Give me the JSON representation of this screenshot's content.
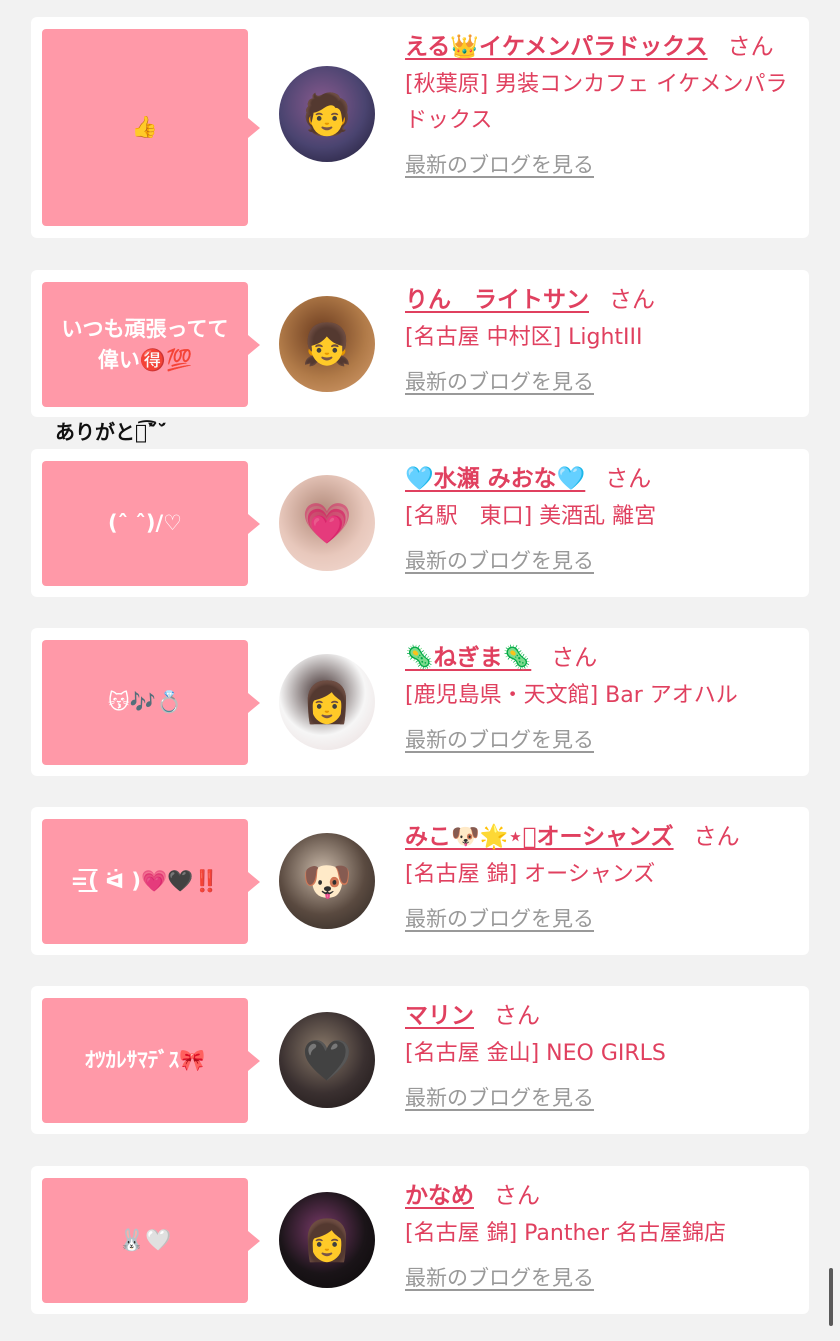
{
  "colors": {
    "accent": "#e0405f",
    "bubble": "#ff99a8",
    "link_gray": "#999999",
    "background": "#f2f2f2"
  },
  "overflow_note": "ありがとう͡˘̋̀˘́",
  "entries": [
    {
      "message": "👍",
      "name": "える👑イケメンパラドックス",
      "suffix": "さん",
      "shop": "[秋葉原] 男装コンカフェ イケメンパラドックス",
      "blog_link": "最新のブログを見る",
      "avatar_icon": "portrait-blue-hair",
      "avatar_colors": [
        "#4a4470",
        "#8a5a8e",
        "#1c1830"
      ]
    },
    {
      "message": "いつも頑張ってて偉い🉐💯",
      "name": "りん　ライトサン",
      "suffix": "さん",
      "shop": "[名古屋 中村区] LightIII",
      "blog_link": "最新のブログを見る",
      "avatar_icon": "portrait-anime-girl",
      "avatar_colors": [
        "#b07a48",
        "#6a3a1e",
        "#d8a070"
      ]
    },
    {
      "message": "(ˆ ˆ)/♡",
      "name": "🩵水瀬 みおな🩵",
      "suffix": "さん",
      "shop": "[名駅　東口] 美酒乱 離宮",
      "blog_link": "最新のブログを見る",
      "avatar_icon": "pink-heart-sticker",
      "avatar_colors": [
        "#e8c8bc",
        "#b08878",
        "#f4dcd4"
      ]
    },
    {
      "message": "😽🎶💍",
      "name": "🦠ねぎま🦠",
      "suffix": "さん",
      "shop": "[鹿児島県・天文館] Bar アオハル",
      "blog_link": "最新のブログを見る",
      "avatar_icon": "portrait-school-uniform",
      "avatar_colors": [
        "#f6f6f6",
        "#3c2a2a",
        "#e8d8d8"
      ]
    },
    {
      "message": "=͟͟͞͞( ᐛ )💗🖤‼️",
      "name": "みこ🐶🌟⋆͛オーシャンズ",
      "suffix": "さん",
      "shop": "[名古屋 錦] オーシャンズ",
      "blog_link": "最新のブログを見る",
      "avatar_icon": "dog-sticker",
      "avatar_colors": [
        "#5a4a40",
        "#c8b8a8",
        "#2a2420"
      ]
    },
    {
      "message": "ｵﾂｶﾚｻﾏﾃﾞｽ🎀",
      "name": "マリン",
      "suffix": "さん",
      "shop": "[名古屋 金山] NEO GIRLS",
      "blog_link": "最新のブログを見る",
      "avatar_icon": "black-heart-sticker",
      "avatar_colors": [
        "#3a3030",
        "#8a7a6a",
        "#1a1414"
      ]
    },
    {
      "message": "🐰🤍",
      "name": "かなめ",
      "suffix": "さん",
      "shop": "[名古屋 錦] Panther 名古屋錦店",
      "blog_link": "最新のブログを見る",
      "avatar_icon": "portrait-dark-stage",
      "avatar_colors": [
        "#1a1418",
        "#7a3a6a",
        "#0a0808"
      ]
    }
  ]
}
